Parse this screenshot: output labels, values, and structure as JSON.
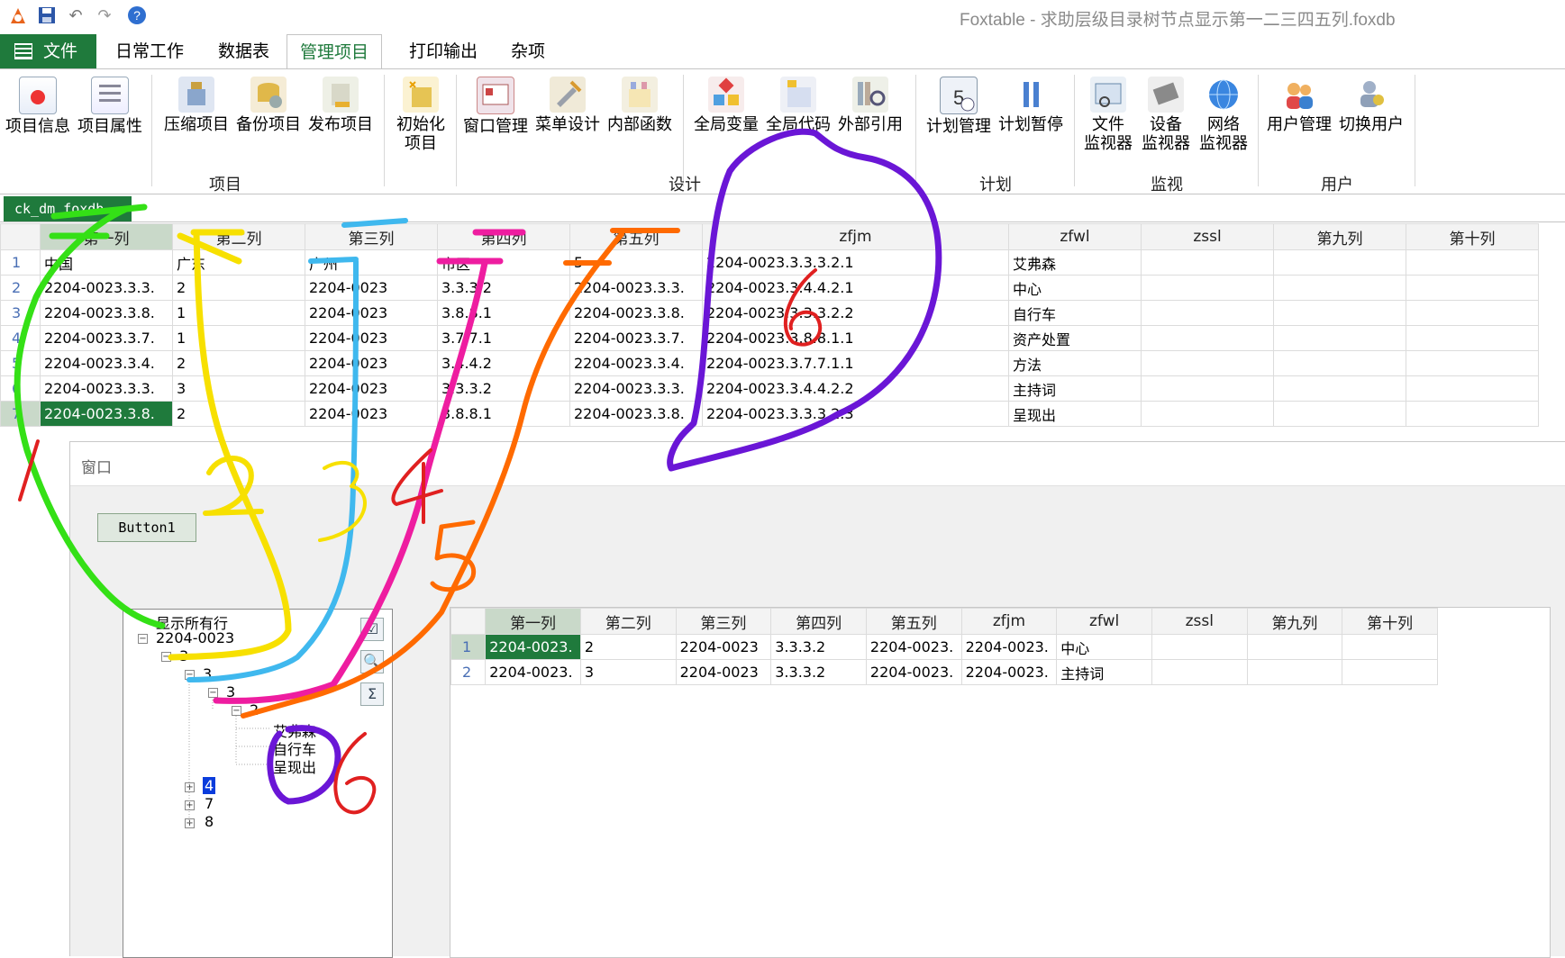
{
  "app": {
    "title": "Foxtable - 求助层级目录树节点显示第一二三四五列.foxdb"
  },
  "quick_access": [
    "app-logo-icon",
    "save-icon",
    "undo-icon",
    "redo-icon",
    "help-icon"
  ],
  "tabs": [
    "文件",
    "日常工作",
    "数据表",
    "管理项目",
    "打印输出",
    "杂项"
  ],
  "active_tab": "管理项目",
  "ribbon": {
    "groups": [
      {
        "label": "项目",
        "buttons": [
          "项目信息",
          "项目属性",
          "压缩项目",
          "备份项目",
          "发布项目",
          "初始化\n项目"
        ]
      },
      {
        "label": "设计",
        "buttons": [
          "窗口管理",
          "菜单设计",
          "内部函数",
          "全局变量",
          "全局代码",
          "外部引用"
        ]
      },
      {
        "label": "计划",
        "buttons": [
          "计划管理",
          "计划暂停"
        ]
      },
      {
        "label": "监视",
        "buttons": [
          "文件\n监视器",
          "设备\n监视器",
          "网络\n监视器"
        ]
      },
      {
        "label": "用户",
        "buttons": [
          "用户管理",
          "切换用户"
        ]
      }
    ]
  },
  "doc_tab": "ck_dm_foxdb",
  "main_grid": {
    "columns": [
      "第一列",
      "第二列",
      "第三列",
      "第四列",
      "第五列",
      "zfjm",
      "zfwl",
      "zssl",
      "第九列",
      "第十列"
    ],
    "rows": [
      [
        "1",
        "中国",
        "广东",
        "广州",
        "市区",
        "5",
        "2204-0023.3.3.3.2.1",
        "艾弗森",
        "",
        "",
        ""
      ],
      [
        "2",
        "2204-0023.3.3.",
        "2",
        "2204-0023",
        "3.3.3.2",
        "2204-0023.3.3.",
        "2204-0023.3.4.4.2.1",
        "中心",
        "",
        "",
        ""
      ],
      [
        "3",
        "2204-0023.3.8.",
        "1",
        "2204-0023",
        "3.8.8.1",
        "2204-0023.3.8.",
        "2204-0023.3.3.3.2.2",
        "自行车",
        "",
        "",
        ""
      ],
      [
        "4",
        "2204-0023.3.7.",
        "1",
        "2204-0023",
        "3.7.7.1",
        "2204-0023.3.7.",
        "2204-0023.3.8.8.1.1",
        "资产处置",
        "",
        "",
        ""
      ],
      [
        "5",
        "2204-0023.3.4.",
        "2",
        "2204-0023",
        "3.4.4.2",
        "2204-0023.3.4.",
        "2204-0023.3.7.7.1.1",
        "方法",
        "",
        "",
        ""
      ],
      [
        "6",
        "2204-0023.3.3.",
        "3",
        "2204-0023",
        "3.3.3.2",
        "2204-0023.3.3.",
        "2204-0023.3.4.4.2.2",
        "主持词",
        "",
        "",
        ""
      ],
      [
        "7",
        "2204-0023.3.8.",
        "2",
        "2204-0023",
        "3.8.8.1",
        "2204-0023.3.8.",
        "2204-0023.3.3.3.2.3",
        "呈现出",
        "",
        "",
        ""
      ]
    ]
  },
  "window": {
    "title": "窗口",
    "button1": "Button1",
    "tree": {
      "root": "显示所有行",
      "nodes": [
        {
          "label": "2204-0023",
          "level": 1,
          "state": "expanded"
        },
        {
          "label": "3",
          "level": 2,
          "state": "expanded"
        },
        {
          "label": "3",
          "level": 3,
          "state": "expanded"
        },
        {
          "label": "3",
          "level": 4,
          "state": "expanded"
        },
        {
          "label": "2",
          "level": 5,
          "state": "expanded"
        },
        {
          "label": "艾弗森",
          "level": 6,
          "state": "leaf"
        },
        {
          "label": "自行车",
          "level": 6,
          "state": "leaf"
        },
        {
          "label": "呈现出",
          "level": 6,
          "state": "leaf"
        },
        {
          "label": "4",
          "level": 3,
          "state": "collapsed-selected"
        },
        {
          "label": "7",
          "level": 3,
          "state": "collapsed"
        },
        {
          "label": "8",
          "level": 3,
          "state": "collapsed"
        }
      ]
    },
    "tools": [
      "checkbox-icon",
      "search-icon",
      "sigma-icon"
    ],
    "sub_grid": {
      "columns": [
        "第一列",
        "第二列",
        "第三列",
        "第四列",
        "第五列",
        "zfjm",
        "zfwl",
        "zssl",
        "第九列",
        "第十列"
      ],
      "rows": [
        [
          "1",
          "2204-0023.",
          "2",
          "2204-0023",
          "3.3.3.2",
          "2204-0023.",
          "2204-0023.",
          "中心",
          "",
          "",
          ""
        ],
        [
          "2",
          "2204-0023.",
          "3",
          "2204-0023",
          "3.3.3.2",
          "2204-0023.",
          "2204-0023.",
          "主持词",
          "",
          "",
          ""
        ]
      ]
    }
  },
  "annotations": {
    "numbers": [
      "1",
      "2",
      "3",
      "4",
      "5",
      "6",
      "6"
    ],
    "colors": [
      "#34e016",
      "#f7e000",
      "#3fb8ee",
      "#ee1da0",
      "#ff6a00",
      "#6a16d6",
      "#e02020"
    ]
  }
}
